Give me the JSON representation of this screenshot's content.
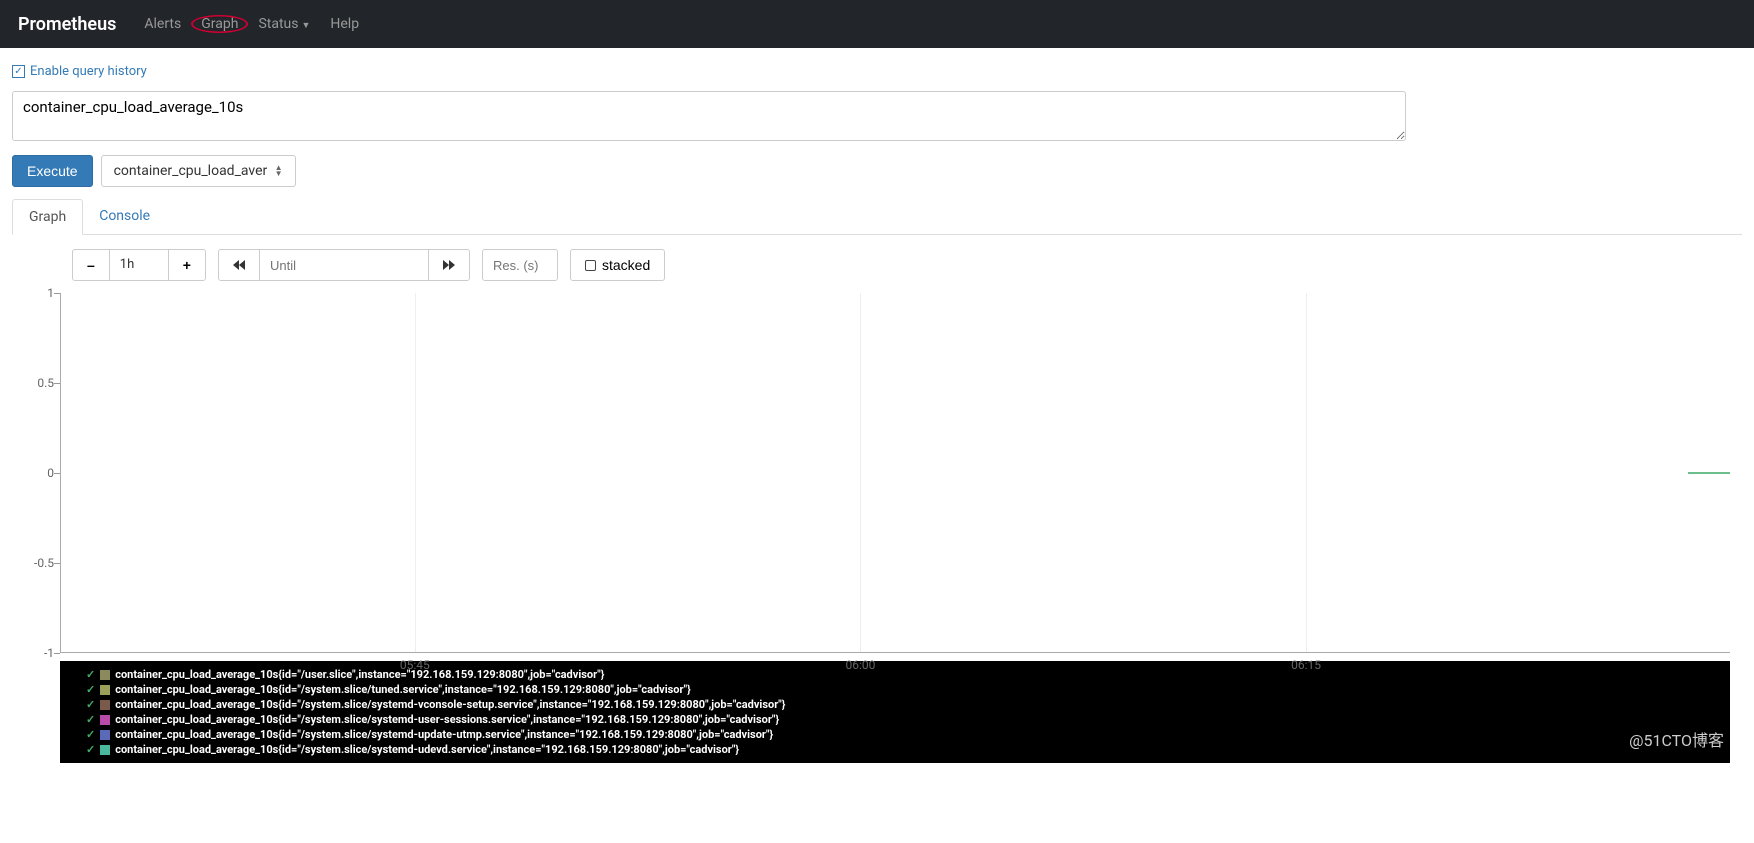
{
  "nav": {
    "brand": "Prometheus",
    "items": [
      "Alerts",
      "Graph",
      "Status",
      "Help"
    ],
    "circled_index": 1,
    "dropdown_index": 2
  },
  "query": {
    "history_label": "Enable query history",
    "expression": "container_cpu_load_average_10s",
    "execute_label": "Execute",
    "metric_select_value": "container_cpu_load_avera"
  },
  "tabs": {
    "items": [
      "Graph",
      "Console"
    ],
    "active_index": 0
  },
  "controls": {
    "minus": "➖",
    "plus": "➕",
    "range": "1h",
    "prev": "◀◀",
    "until_placeholder": "Until",
    "next": "▶▶",
    "res_placeholder": "Res. (s)",
    "stacked_label": "stacked"
  },
  "chart_data": {
    "type": "line",
    "ylim": [
      -1,
      1
    ],
    "y_ticks": [
      -1,
      -0.5,
      0,
      0.5,
      1
    ],
    "x_ticks": [
      "05:45",
      "06:00",
      "06:15"
    ],
    "x_tick_positions_pct": [
      21.2,
      47.9,
      74.6
    ],
    "grid_positions_pct": [
      21.2,
      47.9,
      74.6
    ],
    "series_flat_value": 0,
    "flat_line_start_pct": 97.5
  },
  "legend": [
    {
      "color": "#8a8a5c",
      "label": "container_cpu_load_average_10s{id=\"/user.slice\",instance=\"192.168.159.129:8080\",job=\"cadvisor\"}"
    },
    {
      "color": "#9aa05a",
      "label": "container_cpu_load_average_10s{id=\"/system.slice/tuned.service\",instance=\"192.168.159.129:8080\",job=\"cadvisor\"}"
    },
    {
      "color": "#7a5a4a",
      "label": "container_cpu_load_average_10s{id=\"/system.slice/systemd-vconsole-setup.service\",instance=\"192.168.159.129:8080\",job=\"cadvisor\"}"
    },
    {
      "color": "#b84aa8",
      "label": "container_cpu_load_average_10s{id=\"/system.slice/systemd-user-sessions.service\",instance=\"192.168.159.129:8080\",job=\"cadvisor\"}"
    },
    {
      "color": "#5a6ab8",
      "label": "container_cpu_load_average_10s{id=\"/system.slice/systemd-update-utmp.service\",instance=\"192.168.159.129:8080\",job=\"cadvisor\"}"
    },
    {
      "color": "#4ab89a",
      "label": "container_cpu_load_average_10s{id=\"/system.slice/systemd-udevd.service\",instance=\"192.168.159.129:8080\",job=\"cadvisor\"}"
    }
  ],
  "watermark": "@51CTO博客"
}
